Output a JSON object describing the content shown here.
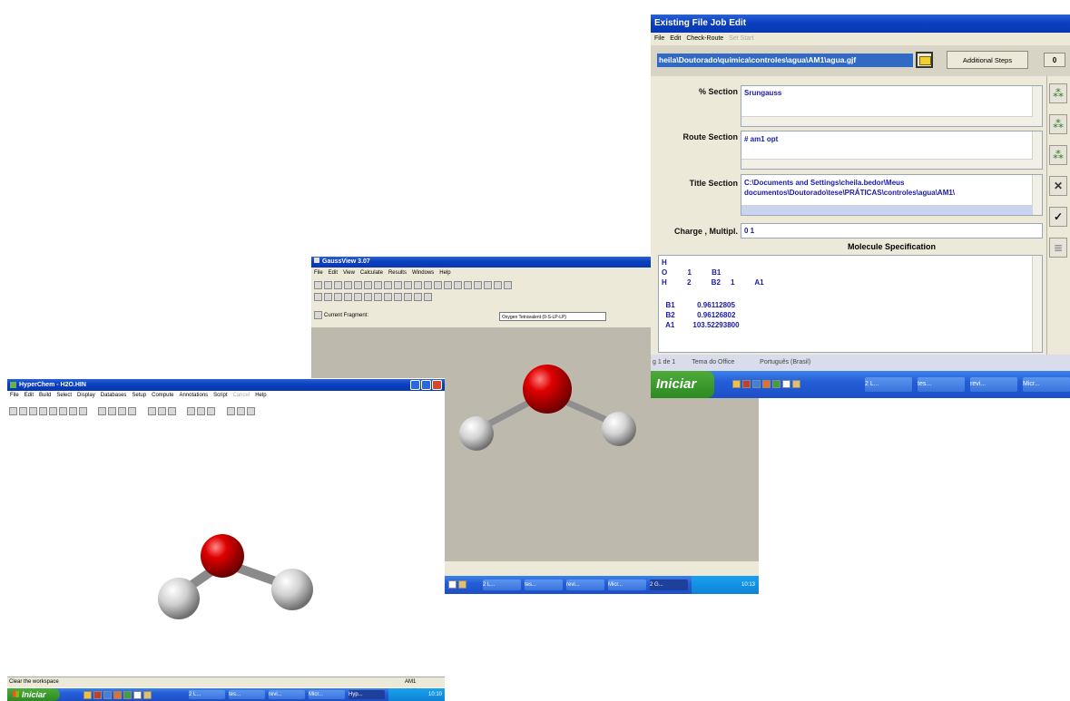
{
  "hyperchem": {
    "title": "HyperChem - H2O.HIN",
    "menu": [
      "File",
      "Edit",
      "Build",
      "Select",
      "Display",
      "Databases",
      "Setup",
      "Compute",
      "Annotations",
      "Script",
      "Cancel",
      "Help"
    ],
    "status_left": "Clear the workspace",
    "status_right": "AM1",
    "taskbar": {
      "start": "Iniciar",
      "buttons": [
        "2 L...",
        "tes...",
        "revi...",
        "Micr...",
        "Hyp..."
      ],
      "clock": "10:10"
    }
  },
  "gaussview": {
    "title": "GaussView 3.07",
    "menu": [
      "File",
      "Edit",
      "View",
      "Calculate",
      "Results",
      "Windows",
      "Help"
    ],
    "current_fragment_label": "Current Fragment:",
    "fragment_value": "Oxygen Tetravalent (0-S-LP-LP)",
    "taskbar": {
      "buttons": [
        "2 L...",
        "tes...",
        "revi...",
        "Micr...",
        "2 G..."
      ],
      "clock": "10:13"
    }
  },
  "job_edit": {
    "title": "Existing File Job Edit",
    "menu": [
      "File",
      "Edit",
      "Check-Route",
      "Set Start"
    ],
    "path": "heila\\Doutorado\\quimica\\controles\\agua\\AM1\\agua.gjf",
    "additional_steps": "Additional Steps",
    "step_count": "0",
    "percent_section_label": "% Section",
    "percent_section_value": "Srungauss",
    "route_section_label": "Route Section",
    "route_section_value": "# am1 opt",
    "title_section_label": "Title Section",
    "title_section_line1": "C:\\Documents and Settings\\cheila.bedor\\Meus",
    "title_section_line2": "documentos\\Doutorado\\tese\\PRÁTICAS\\controles\\agua\\AM1\\",
    "charge_label": "Charge , Multipl.",
    "charge_value": "0 1",
    "molecule_header": "Molecule Specification",
    "molecule_lines": [
      "H",
      "O          1          B1",
      "H          2          B2     1          A1",
      "",
      "  B1           0.96112805",
      "  B2           0.96126802",
      "  A1         103.52293800"
    ],
    "behind_status": [
      "g 1 de 1",
      "Tema do Office",
      "Português (Brasil)"
    ],
    "taskbar": {
      "start": "Iniciar",
      "buttons": [
        "2 L...",
        "tes...",
        "revi...",
        "Micr..."
      ]
    }
  }
}
